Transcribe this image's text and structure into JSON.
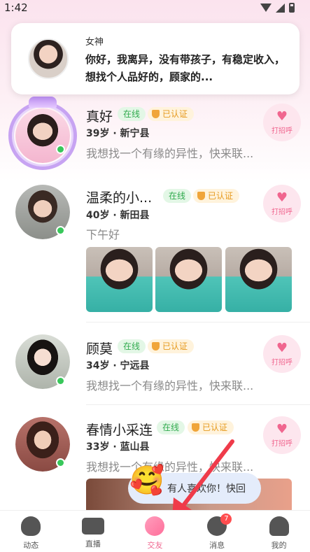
{
  "status_bar": {
    "time": "1:42"
  },
  "notification": {
    "sender": "女神",
    "text": "你好，我离异，没有带孩子，有稳定收入，想找个人品好的，顾家的..."
  },
  "users": [
    {
      "name": "真好",
      "online": "在线",
      "verified": "已认证",
      "meta": "39岁 · 新宁县",
      "bio": "我想找一个有缘的异性，快来联...",
      "greet": "打招呼"
    },
    {
      "name": "温柔的小...",
      "online": "在线",
      "verified": "已认证",
      "meta": "40岁 · 新田县",
      "bio": "下午好",
      "greet": "打招呼"
    },
    {
      "name": "顾莫",
      "online": "在线",
      "verified": "已认证",
      "meta": "34岁 · 宁远县",
      "bio": "我想找一个有缘的异性，快来联...",
      "greet": "打招呼"
    },
    {
      "name": "春情小采连",
      "online": "在线",
      "verified": "已认证",
      "meta": "33岁 · 蓝山县",
      "bio": "我想找一个有缘的异性，快来联...",
      "greet": "打招呼"
    }
  ],
  "toast": {
    "emoji": "🥰",
    "message": "有人喜欢你！快回"
  },
  "bottom_nav": [
    {
      "label": "动态",
      "icon": "heart-chat-icon"
    },
    {
      "label": "直播",
      "icon": "camera-icon"
    },
    {
      "label": "交友",
      "icon": "pentagon-icon",
      "active": true
    },
    {
      "label": "消息",
      "icon": "message-icon",
      "badge": "7"
    },
    {
      "label": "我的",
      "icon": "user-icon"
    }
  ],
  "colors": {
    "accent": "#f0668f",
    "online": "#38c75a",
    "verified": "#e69a1e"
  }
}
